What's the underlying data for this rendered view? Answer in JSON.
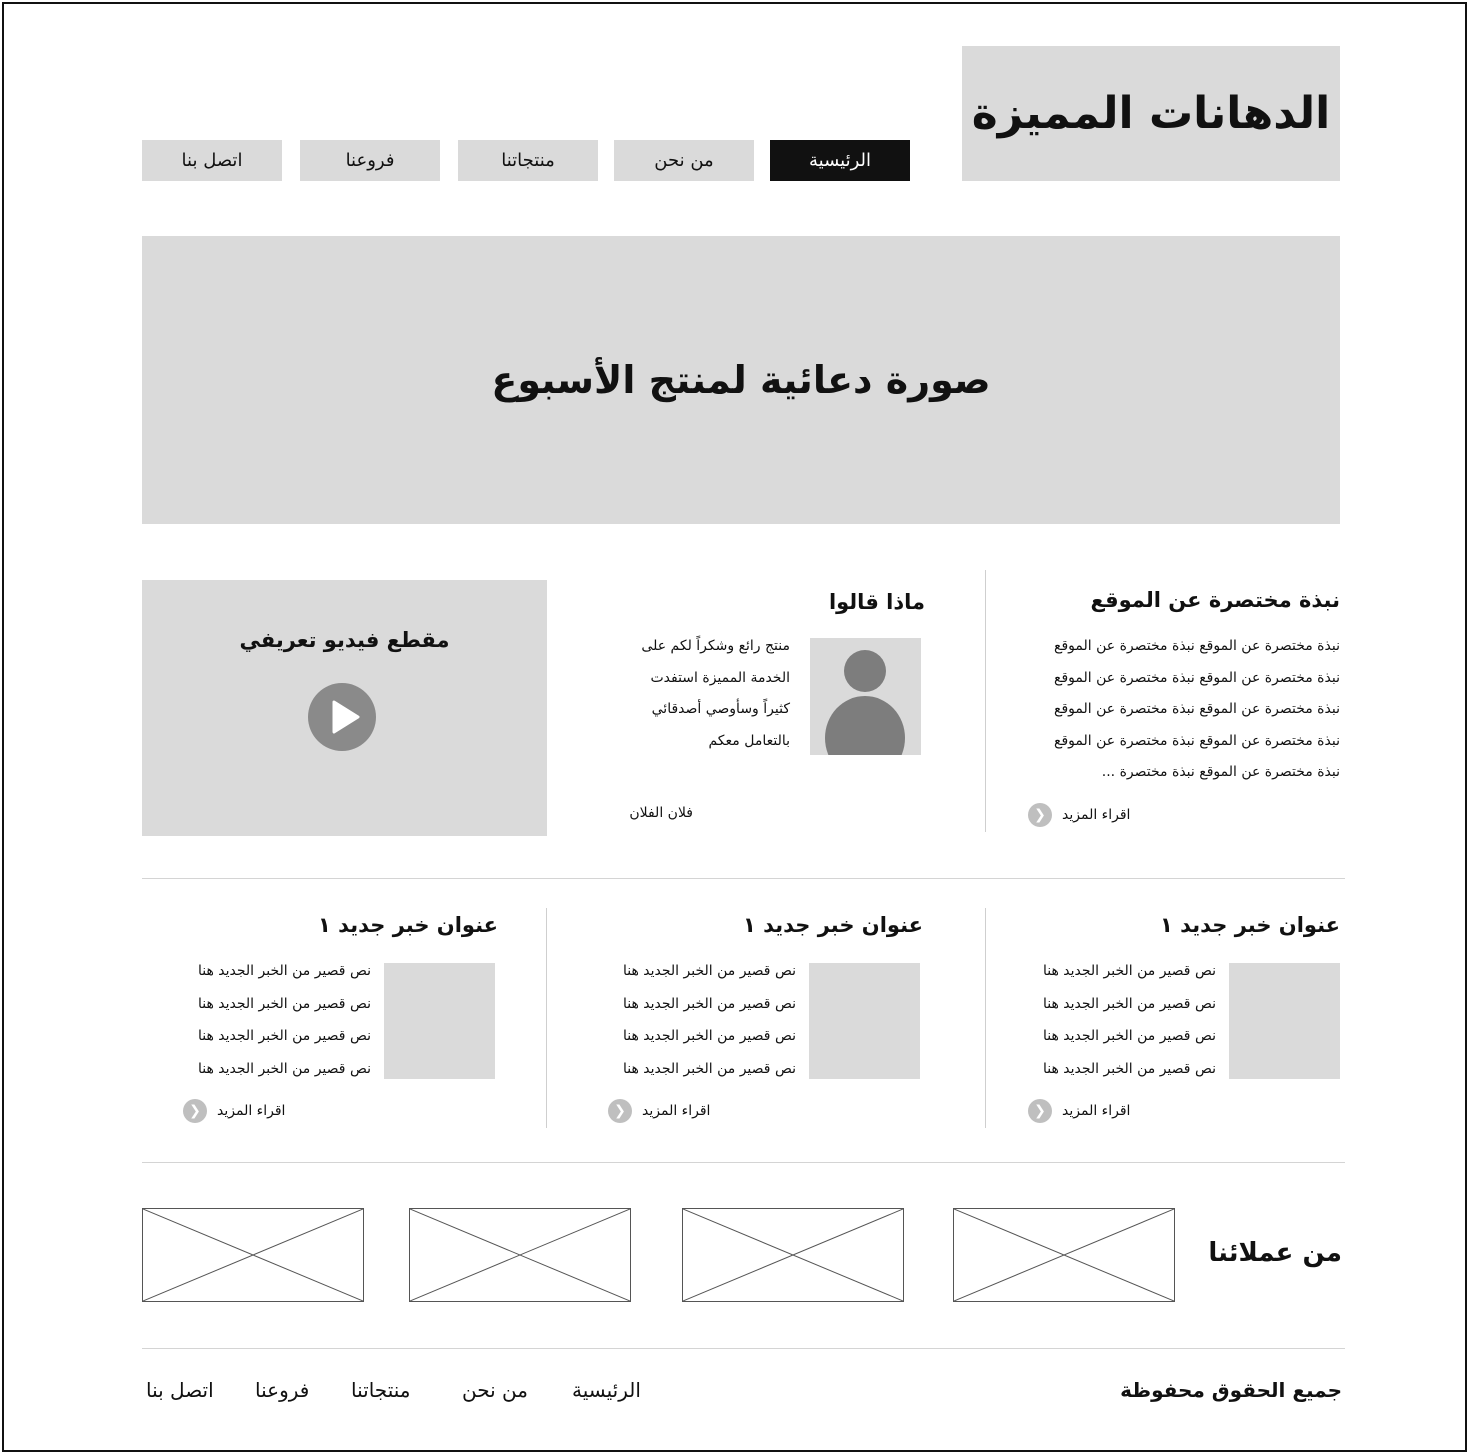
{
  "site": {
    "title": "الدهانات المميزة"
  },
  "nav": {
    "home": "الرئيسية",
    "about": "من نحن",
    "products": "منتجاتنا",
    "branches": "فروعنا",
    "contact": "اتصل بنا"
  },
  "hero": {
    "text": "صورة دعائية لمنتج الأسبوع"
  },
  "about": {
    "title": "نبذة مختصرة عن الموقع",
    "lines": [
      "نبذة مختصرة عن الموقع نبذة مختصرة عن الموقع",
      "نبذة مختصرة عن الموقع نبذة مختصرة عن الموقع",
      "نبذة مختصرة عن الموقع نبذة مختصرة عن الموقع",
      "نبذة مختصرة عن الموقع نبذة مختصرة عن الموقع",
      "نبذة مختصرة عن الموقع نبذة مختصرة ..."
    ],
    "more": "اقراء المزيد"
  },
  "testimonial": {
    "title": "ماذا قالوا",
    "lines": [
      "منتج رائع وشكراً لكم على",
      "الخدمة المميزة استفدت",
      "كثيراً وسأوصي أصدقائي",
      "بالتعامل معكم"
    ],
    "author": "فلان الفلان"
  },
  "video": {
    "title": "مقطع فيديو تعريفي"
  },
  "news": [
    {
      "title": "عنوان خبر جديد ١",
      "lines": [
        "نص قصير من الخبر الجديد هنا",
        "نص قصير من الخبر الجديد هنا",
        "نص قصير من الخبر الجديد هنا",
        "نص قصير من الخبر الجديد هنا"
      ],
      "more": "اقراء المزيد"
    },
    {
      "title": "عنوان خبر جديد ١",
      "lines": [
        "نص قصير من الخبر الجديد هنا",
        "نص قصير من الخبر الجديد هنا",
        "نص قصير من الخبر الجديد هنا",
        "نص قصير من الخبر الجديد هنا"
      ],
      "more": "اقراء المزيد"
    },
    {
      "title": "عنوان خبر جديد ١",
      "lines": [
        "نص قصير من الخبر الجديد هنا",
        "نص قصير من الخبر الجديد هنا",
        "نص قصير من الخبر الجديد هنا",
        "نص قصير من الخبر الجديد هنا"
      ],
      "more": "اقراء المزيد"
    }
  ],
  "clients": {
    "title": "من عملائنا"
  },
  "footer": {
    "copyright": "جميع الحقوق محفوظة",
    "home": "الرئيسية",
    "about": "من نحن",
    "products": "منتجاتنا",
    "branches": "فروعنا",
    "contact": "اتصل بنا"
  },
  "colors": {
    "placeholder": "#dadada",
    "active_nav": "#111111",
    "icon_gray": "#8a8a8a"
  }
}
